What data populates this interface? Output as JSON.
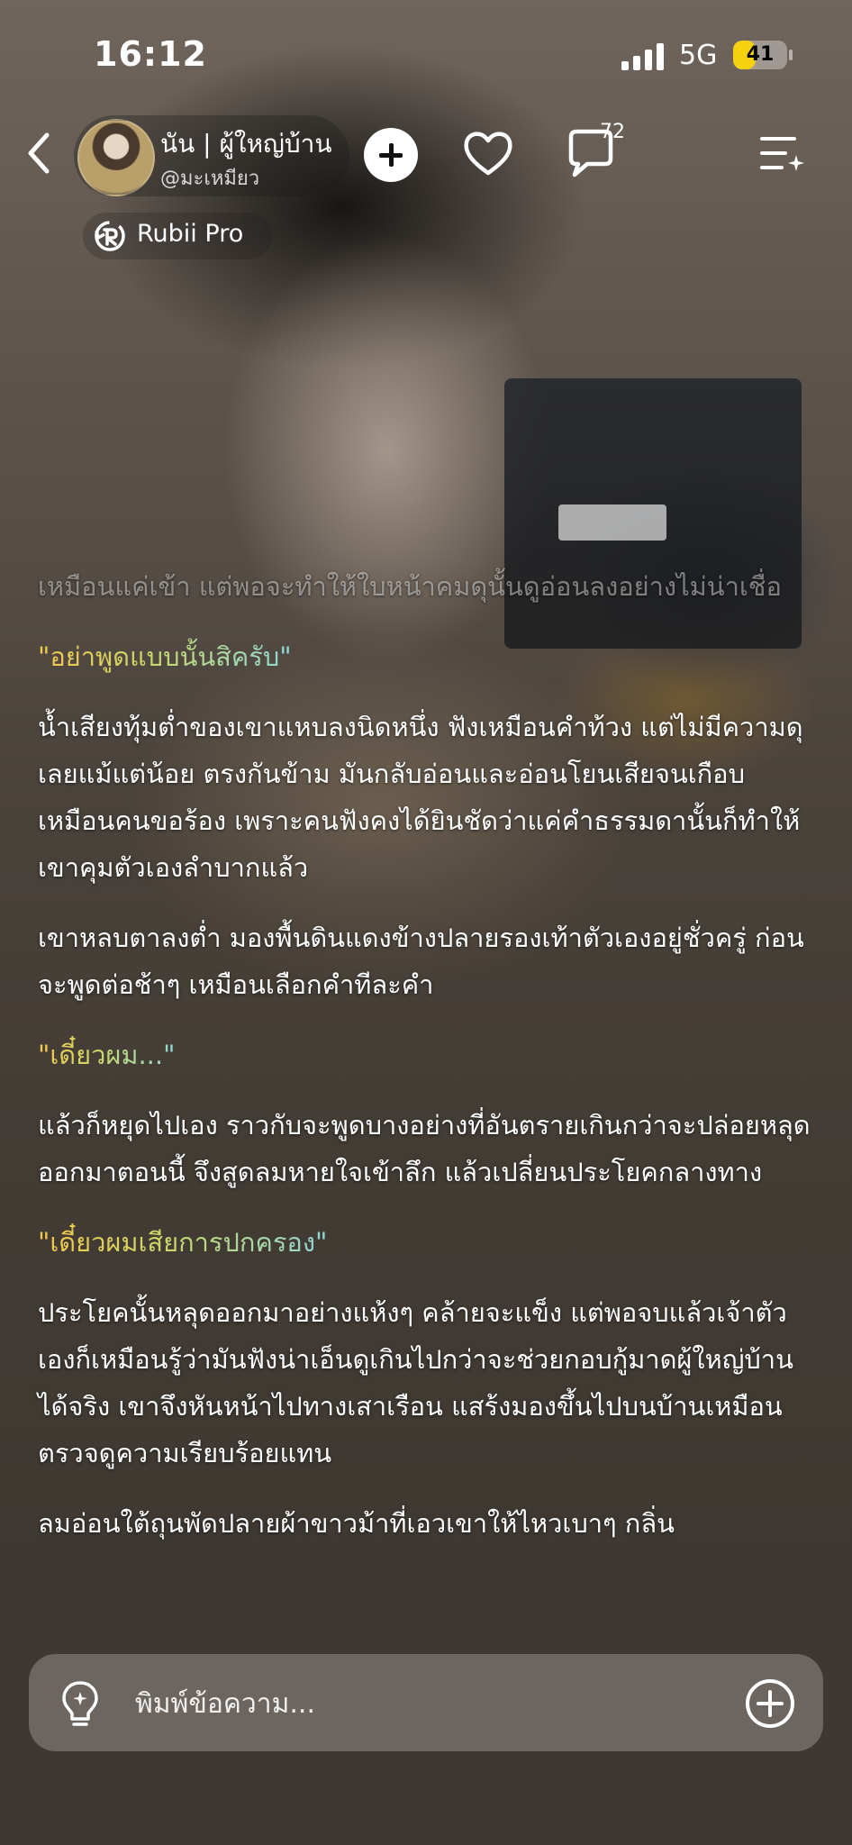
{
  "status_bar": {
    "time": "16:12",
    "network": "5G",
    "battery": "41",
    "battery_level": 0.41,
    "battery_color": "#f5d10f"
  },
  "header": {
    "character_name": "นัน | ผู้ใหญ่บ้าน",
    "creator_handle": "@มะเหมียว",
    "comment_count": "72",
    "subscription_label": "Rubii Pro",
    "icons": [
      "back-icon",
      "plus-icon",
      "heart-icon",
      "comment-icon",
      "menu-sparkle-icon",
      "rubii-pro-icon"
    ]
  },
  "story": {
    "paragraphs": [
      {
        "kind": "narration-faded",
        "text": "เหมือนแค่เข้า แต่พอจะทำให้ใบหน้าคมดุนั้นดูอ่อนลงอย่างไม่น่าเชื่อ"
      },
      {
        "kind": "dialogue",
        "text": "\"อย่าพูดแบบนั้นสิครับ\""
      },
      {
        "kind": "narration",
        "text": "น้ำเสียงทุ้มต่ำของเขาแหบลงนิดหนึ่ง ฟังเหมือนคำท้วง แต่ไม่มีความดุเลยแม้แต่น้อย ตรงกันข้าม มันกลับอ่อนและอ่อนโยนเสียจนเกือบเหมือนคนขอร้อง เพราะคนฟังคงได้ยินชัดว่าแค่คำธรรมดานั้นก็ทำให้เขาคุมตัวเองลำบากแล้ว"
      },
      {
        "kind": "narration",
        "text": "เขาหลบตาลงต่ำ มองพื้นดินแดงข้างปลายรองเท้าตัวเองอยู่ชั่วครู่ ก่อนจะพูดต่อช้าๆ เหมือนเลือกคำทีละคำ"
      },
      {
        "kind": "dialogue",
        "text": "\"เดี๋ยวผม...\""
      },
      {
        "kind": "narration",
        "text": "แล้วก็หยุดไปเอง ราวกับจะพูดบางอย่างที่อันตรายเกินกว่าจะปล่อยหลุดออกมาตอนนี้ จึงสูดลมหายใจเข้าลึก แล้วเปลี่ยนประโยคกลางทาง"
      },
      {
        "kind": "dialogue",
        "text": "\"เดี๋ยวผมเสียการปกครอง\""
      },
      {
        "kind": "narration",
        "text": "ประโยคนั้นหลุดออกมาอย่างแห้งๆ คล้ายจะแข็ง แต่พอจบแล้วเจ้าตัวเองก็เหมือนรู้ว่ามันฟังน่าเอ็นดูเกินไปกว่าจะช่วยกอบกู้มาดผู้ใหญ่บ้านได้จริง เขาจึงหันหน้าไปทางเสาเรือน แสร้งมองขึ้นไปบนบ้านเหมือนตรวจดูความเรียบร้อยแทน"
      },
      {
        "kind": "narration",
        "text": "ลมอ่อนใต้ถุนพัดปลายผ้าขาวม้าที่เอวเขาให้ไหวเบาๆ กลิ่น"
      }
    ]
  },
  "composer": {
    "placeholder": "พิมพ์ข้อความ...",
    "icons": [
      "lightbulb-icon",
      "plus-circle-icon"
    ]
  }
}
